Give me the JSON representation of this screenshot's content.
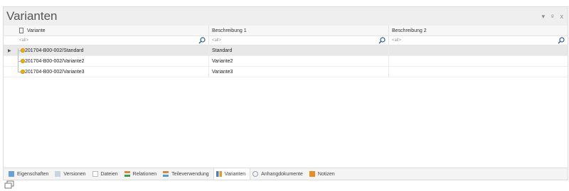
{
  "panel": {
    "title": "Varianten",
    "controls": [
      "▾",
      "ᵍ",
      "x"
    ]
  },
  "columns": [
    {
      "label": "Variante"
    },
    {
      "label": "Beschreibung 1"
    },
    {
      "label": "Beschreibung 2"
    }
  ],
  "filters": [
    {
      "placeholder": "<all>"
    },
    {
      "placeholder": "<all>"
    },
    {
      "placeholder": "<all>"
    }
  ],
  "rows": [
    {
      "variante": "201704-B00-002/Standard",
      "beschreibung1": "Standard",
      "beschreibung2": ""
    },
    {
      "variante": "201704-B00-002/Variante2",
      "beschreibung1": "Variante2",
      "beschreibung2": ""
    },
    {
      "variante": "201704-B00-002/Variante3",
      "beschreibung1": "Variante3",
      "beschreibung2": ""
    }
  ],
  "tabs": [
    {
      "label": "Eigenschaften",
      "icon": "properties-icon",
      "color": "#6aa0d8"
    },
    {
      "label": "Versionen",
      "icon": "versions-icon",
      "color": "#a8b8d0"
    },
    {
      "label": "Dateien",
      "icon": "files-icon",
      "color": "#bbbbbb"
    },
    {
      "label": "Relationen",
      "icon": "relations-icon",
      "color": "#d88a3a"
    },
    {
      "label": "Teileverwendung",
      "icon": "usage-icon",
      "color": "#4aa0d0"
    },
    {
      "label": "Varianten",
      "icon": "variants-icon",
      "color": "#4a7fc8"
    },
    {
      "label": "Anhangdokumente",
      "icon": "attachment-icon",
      "color": "#9aa0b0"
    },
    {
      "label": "Notizen",
      "icon": "notes-icon",
      "color": "#f08a1a"
    }
  ],
  "active_tab": "Varianten"
}
